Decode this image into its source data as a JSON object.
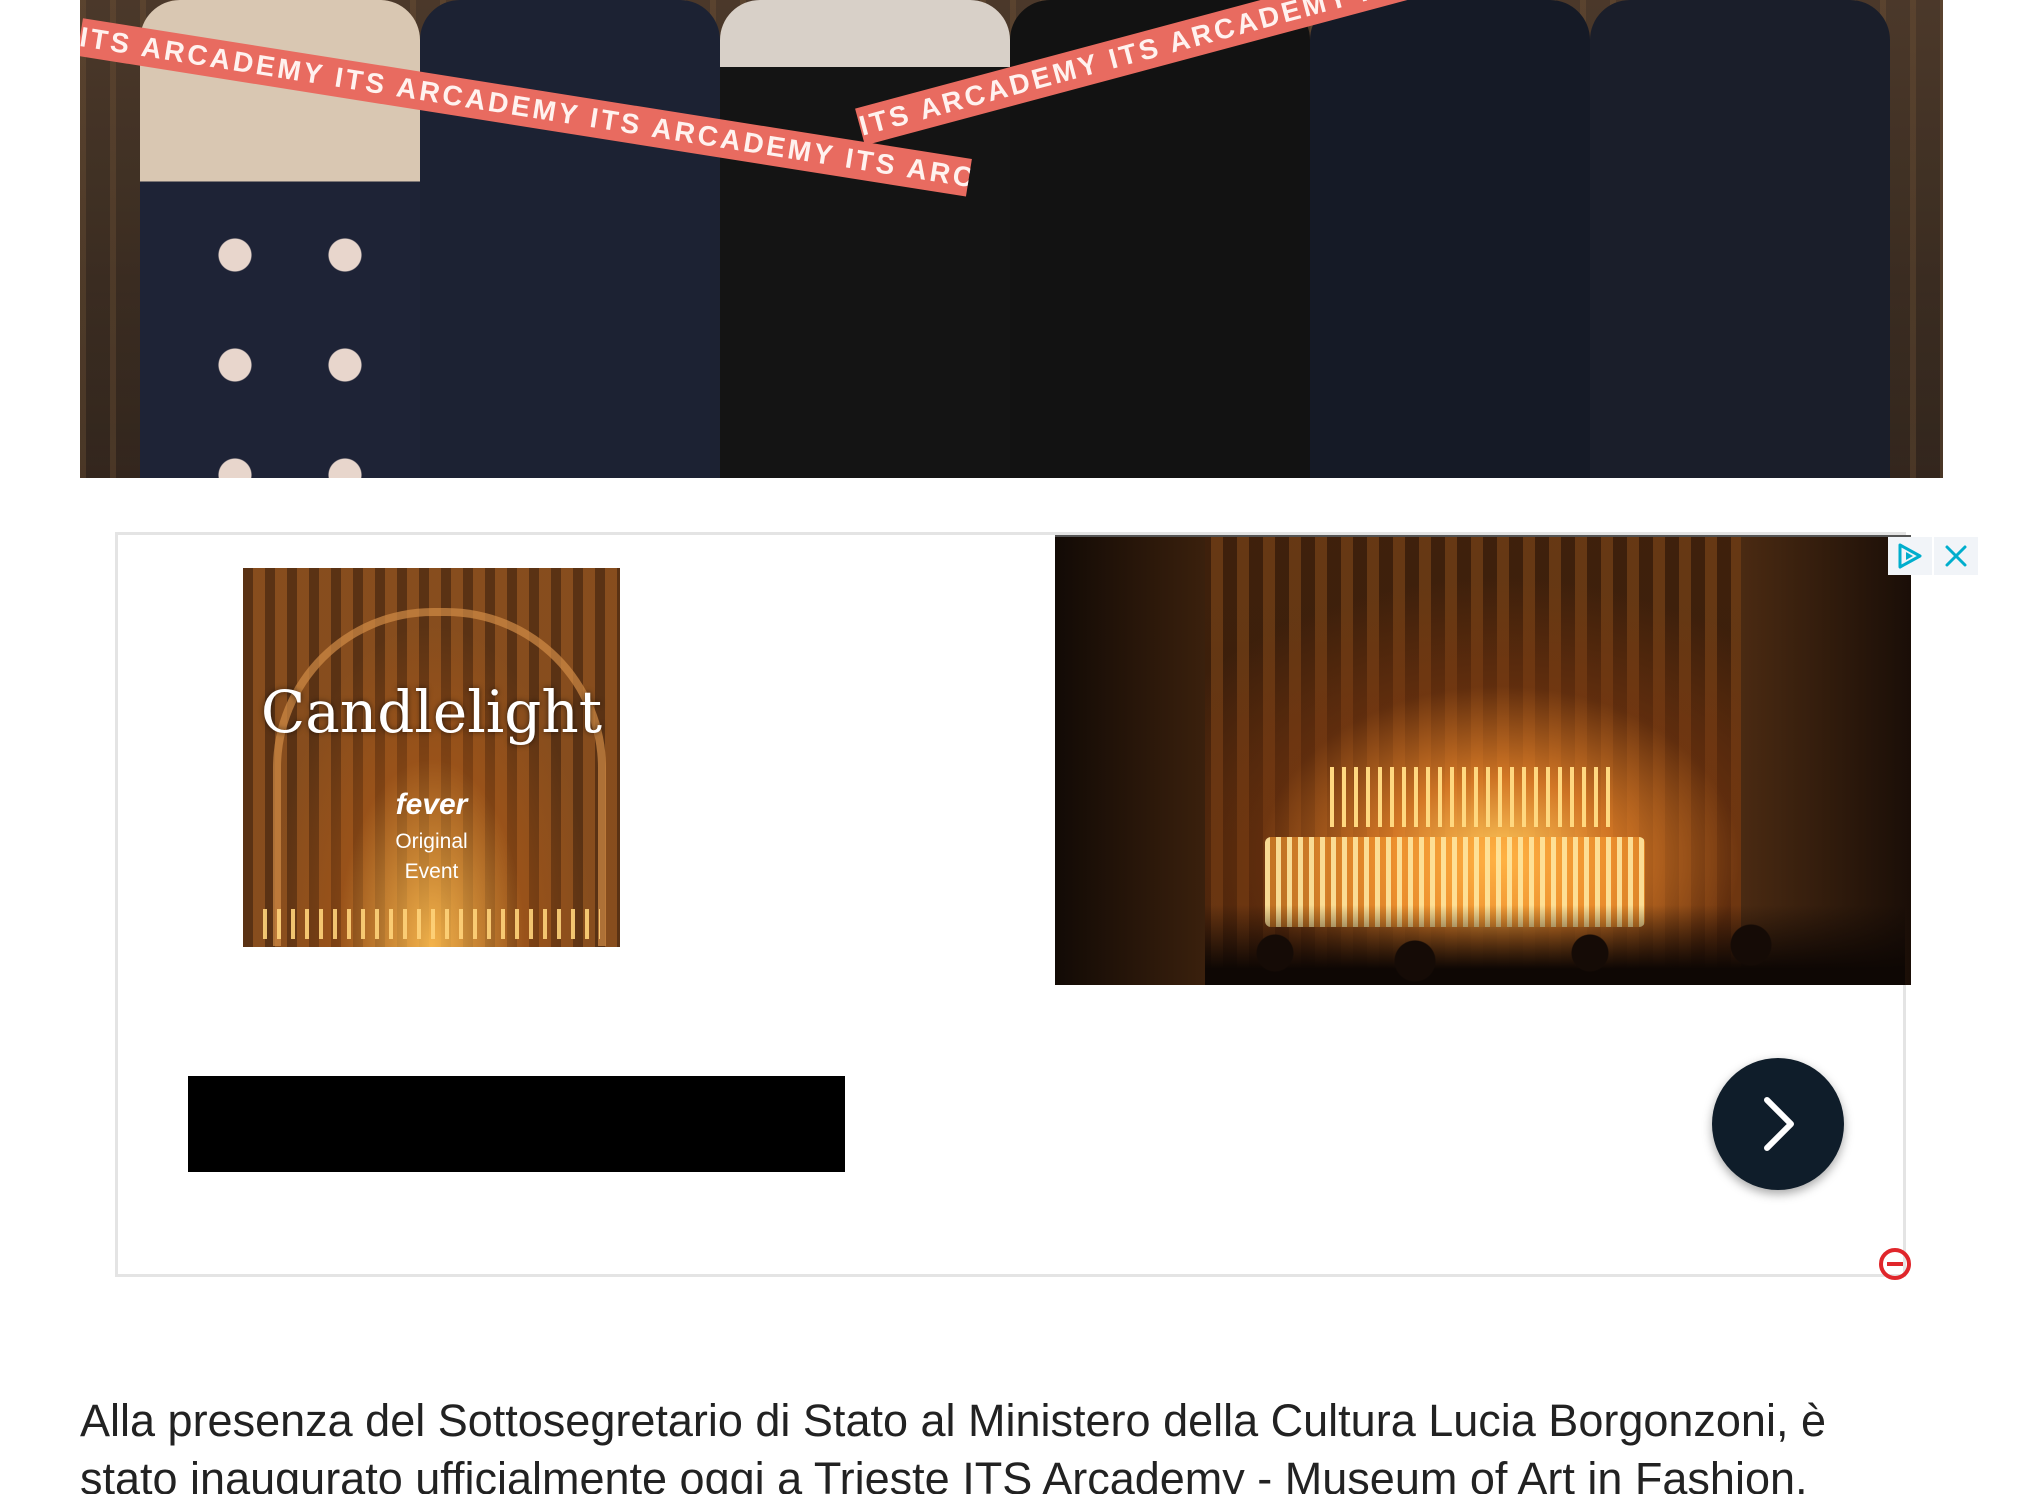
{
  "hero": {
    "ribbon_text": "ITS ARCADEMY ITS ARCADEMY ITS ARCADEMY ITS ARCADEMY ITS ARCADEMY ITS ARCADEMY ITS ARCADEMY"
  },
  "ad": {
    "thumb_title": "Candlelight",
    "thumb_brand": "fever",
    "thumb_sub1": "Original",
    "thumb_sub2": "Event",
    "adchoices_icon": "adchoices-icon",
    "close_icon": "close-icon",
    "next_icon": "chevron-right-icon",
    "provider_icon": "provider-logo-icon"
  },
  "article": {
    "line1": "Alla presenza del Sottosegretario di Stato al Ministero della Cultura Lucia Borgonzoni, è",
    "line2": "stato inaugurato ufficialmente oggi a Trieste ITS Arcademy - Museum of Art in Fashion,"
  },
  "colors": {
    "ribbon": "#e86b60",
    "next_button": "#0f1d2a",
    "adchoices": "#00aecd"
  }
}
